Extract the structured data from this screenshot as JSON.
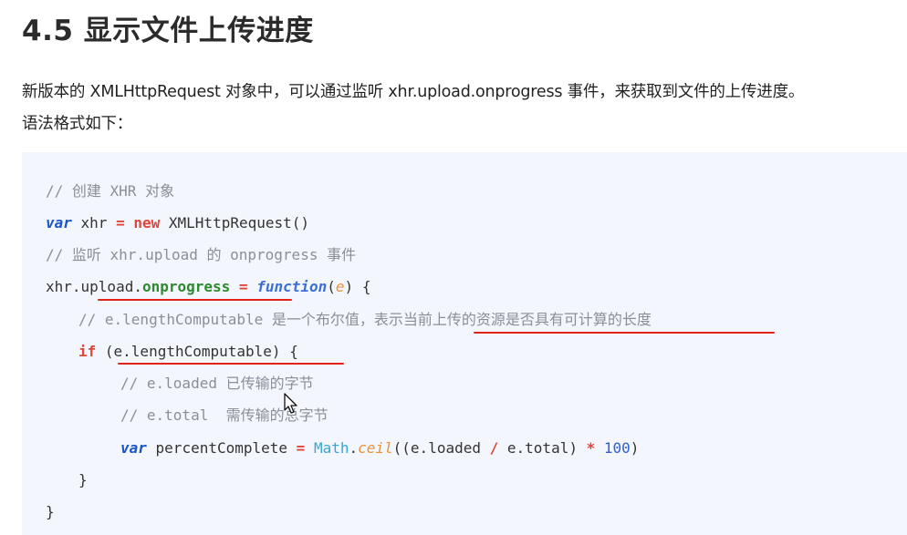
{
  "heading": "4.5 显示文件上传进度",
  "intro": {
    "line1": "新版本的 XMLHttpRequest 对象中，可以通过监听 xhr.upload.onprogress 事件，来获取到文件的上传进度。",
    "line2": "语法格式如下："
  },
  "code": {
    "l1": "// 创建 XHR 对象",
    "l2_kw": "var",
    "l2_a": " xhr ",
    "l2_eq": "=",
    "l2_b": " ",
    "l2_new": "new",
    "l2_c": " XMLHttpRequest()",
    "l3": "// 监听 xhr.upload 的 onprogress 事件",
    "l4_a": "xhr.upload.",
    "l4_prop": "onprogress",
    "l4_eq": " = ",
    "l4_fn": "function",
    "l4_p1": "(",
    "l4_param": "e",
    "l4_p2": ") {",
    "l5": "// e.lengthComputable 是一个布尔值，表示当前上传的资源是否具有可计算的长度",
    "l6_if": "if",
    "l6_rest": " (e.lengthComputable) {",
    "l7": "// e.loaded 已传输的字节",
    "l8": "// e.total  需传输的总字节",
    "l9_var": "var",
    "l9_a": " percentComplete ",
    "l9_eq": "=",
    "l9_b": " ",
    "l9_math": "Math",
    "l9_dot": ".",
    "l9_ceil": "ceil",
    "l9_c": "((e.loaded ",
    "l9_div": "/",
    "l9_d": " e.total) ",
    "l9_mul": "*",
    "l9_e": " ",
    "l9_num": "100",
    "l9_f": ")",
    "l10": "}",
    "l11": "}"
  },
  "colors": {
    "code_background": "#f3f6fc",
    "keyword": "#1a55c9",
    "keyword_red": "#e0453a",
    "property_green": "#2e8a2e",
    "comment": "#8a8f98",
    "annotation_underline": "#e2231a"
  },
  "icons": [
    "mouse-cursor-icon"
  ]
}
